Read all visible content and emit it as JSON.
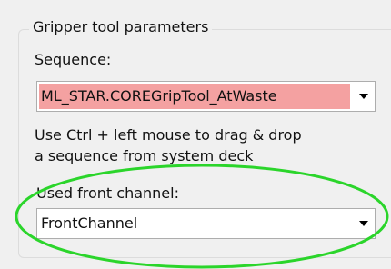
{
  "groupbox": {
    "title": "Gripper tool parameters"
  },
  "sequence": {
    "label": "Sequence:",
    "value": "ML_STAR.COREGripTool_AtWaste",
    "highlight_color": "#f4a1a1"
  },
  "hint": {
    "line1": "Use Ctrl + left mouse to drag & drop",
    "line2": "a sequence from system deck"
  },
  "front_channel": {
    "label": "Used front channel:",
    "value": "FrontChannel"
  },
  "annotation": {
    "ellipse_color": "#2bd52b"
  },
  "icons": {
    "dropdown": "chevron-down-icon"
  }
}
